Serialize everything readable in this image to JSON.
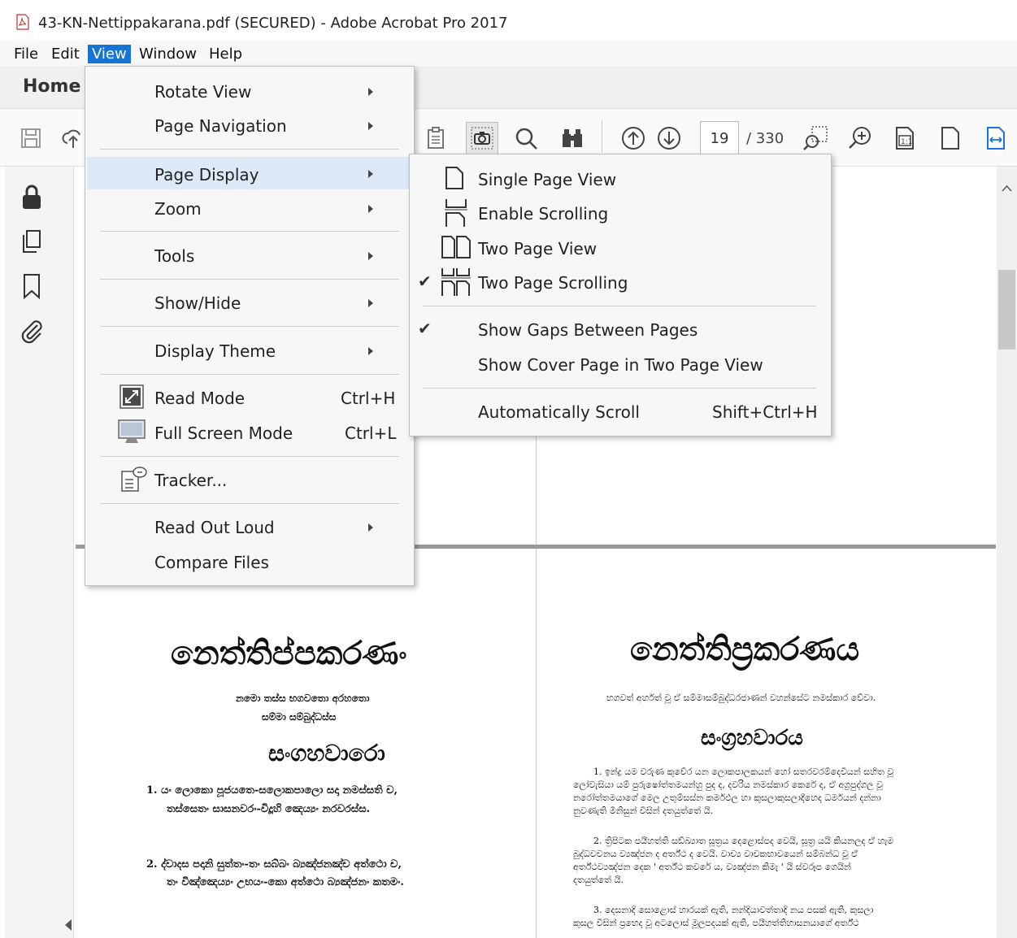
{
  "window": {
    "title": "43-KN-Nettippakarana.pdf (SECURED) - Adobe Acrobat Pro 2017"
  },
  "menubar": {
    "items": [
      "File",
      "Edit",
      "View",
      "Window",
      "Help"
    ],
    "active": "View"
  },
  "tabs": {
    "home": "Home"
  },
  "toolbar": {
    "current_page": "19",
    "total_pages": "/ 330",
    "icons": [
      "save-icon",
      "cloud-upload-icon",
      "clipboard-icon",
      "snapshot-icon",
      "search-icon",
      "binoculars-icon",
      "page-up-icon",
      "page-down-icon",
      "marquee-zoom-icon",
      "zoom-icon",
      "actual-size-icon",
      "fit-page-icon",
      "fit-width-icon"
    ]
  },
  "leftrail": {
    "icons": [
      "lock-icon",
      "copy-pages-icon",
      "bookmark-icon",
      "attachment-icon"
    ]
  },
  "view_menu": {
    "items": [
      {
        "label": "Rotate View",
        "submenu": true
      },
      {
        "label": "Page Navigation",
        "submenu": true
      },
      {
        "label": "Page Display",
        "submenu": true,
        "highlighted": true
      },
      {
        "label": "Zoom",
        "submenu": true
      },
      {
        "label": "Tools",
        "submenu": true
      },
      {
        "label": "Show/Hide",
        "submenu": true
      },
      {
        "label": "Display Theme",
        "submenu": true
      },
      {
        "label": "Read Mode",
        "shortcut": "Ctrl+H",
        "icon": "read-mode-icon"
      },
      {
        "label": "Full Screen Mode",
        "shortcut": "Ctrl+L",
        "icon": "full-screen-icon"
      },
      {
        "label": "Tracker...",
        "icon": "tracker-icon"
      },
      {
        "label": "Read Out Loud",
        "submenu": true
      },
      {
        "label": "Compare Files"
      }
    ]
  },
  "page_display_submenu": {
    "items": [
      {
        "label": "Single Page View",
        "icon": "single-page-icon",
        "checked": false
      },
      {
        "label": "Enable Scrolling",
        "icon": "scrolling-icon",
        "checked": false
      },
      {
        "label": "Two Page View",
        "icon": "two-page-icon",
        "checked": false
      },
      {
        "label": "Two Page Scrolling",
        "icon": "two-page-scrolling-icon",
        "checked": true
      },
      {
        "label": "Show Gaps Between Pages",
        "checked": true
      },
      {
        "label": "Show Cover Page in Two Page View",
        "checked": false
      },
      {
        "label": "Automatically Scroll",
        "shortcut": "Shift+Ctrl+H"
      }
    ]
  },
  "document": {
    "left_page": {
      "title": "නෙත්තිප්පකරණං",
      "line1": "නමො තස්ස භගවතො අරහතො",
      "line2": "සම්මා සම්බුද්ධස්ස",
      "heading": "සංගහවාරො",
      "p1a": "1.  යං ලොකො පූජයතෙ-සලොකපාලො සදා නමස්සති ච,",
      "p1b": "තස්සෙතං සාසනවරං-විදූහි ඤෙය්‍යං නරවරස්ස.",
      "p2a": "2.  ද්වාදස පදානි සුත්තං-තං සබ්බං බ්‍යඤ්ජනඤ්ච අත්ථො ච,",
      "p2b": "තං විඤ්ඤෙය්‍යං උභයං-කො අත්ථො බ්‍යඤ්ජනං කතමං."
    },
    "right_page": {
      "title": "නෙත්තිප්‍රකරණය",
      "line1": "භගවත් අර්හත් වූ ඒ සම්මාසම්බුද්ධරජාණන් වහන්සේට නමස්කාර වේවා.",
      "heading": "සංග්‍රහවාරය",
      "p1a": "1.  ඉන්ද්‍ර යම වරුණ කුවේර යන ලොකපාලකයන් හෝ සතරවරම්දෙවියන් සහිත වූ",
      "p1b": "ලෝවැසියා යම් පුරුෂෝත්තමයන්හු පුද ද, දවරිය නමස්කාර කෙරේ ද, ඒ අග්‍රපුද්ගල වූ",
      "p1c": "නරෝත්තමයාගේ මෙල උතුම්සස්න කර්මඵල හා කුසලාකුසලාදීහෙද ධර්මයන් දන්නා",
      "p1d": "නුවණැති මිනිසුන් විසින් දතයුත්තේ යි.",
      "p2a": "2.  ත්‍රිපිටක පයීහත්ති සඞ්ඛ්‍යාත සූත්‍රය දෙළොස්පද වෙයි, සූත්‍ර යයි කියනලද ඒ හැම",
      "p2b": "බුද්ධවචනය ව්‍යඤ්ජන ද අර්ත්ථ ද වෙයි.  වාච්‍ය වාචකභාවයෙන් සම්බන්ධ වූ ඒ",
      "p2c": "අර්ත්ථව්‍යඤ්ජන දෙක ' අර්ත්ථ කවරේ ය, ව්‍යඤ්ජන කිමැ ' යි ස්වරූප ගෙයින්",
      "p2d": "දතයුත්තේ යි.",
      "p3a": "3.  දෙසනාදි සොළොස් හාරයක් ඇති, නන්දියාවත්තාදි නය පසක් ඇති, කුසලා",
      "p3b": "කුසල විසින් ප්‍රභෙද වූ අටලොස් මූලපදයක් ඇති, පයීහත්තිහාසනයාගේ අර්ත්ථ"
    }
  }
}
